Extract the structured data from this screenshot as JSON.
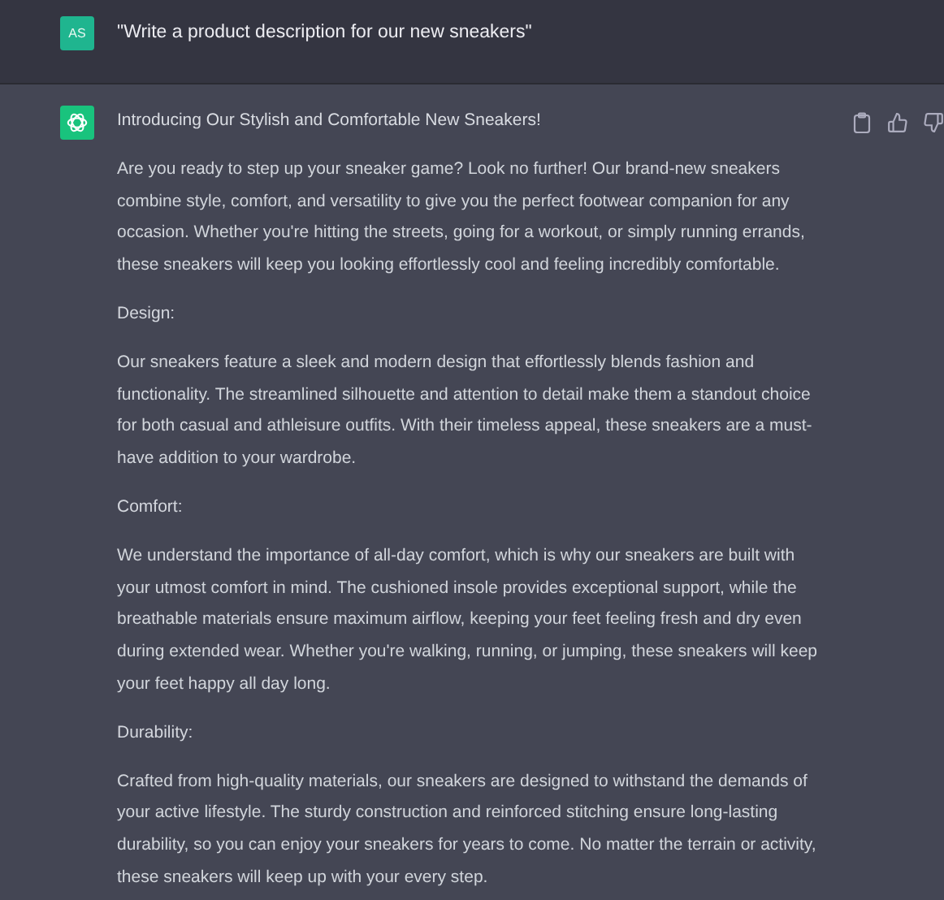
{
  "user_message": {
    "avatar": "AS",
    "text": "\"Write a product description for our new sneakers\""
  },
  "assistant_message": {
    "paragraphs": [
      {
        "kind": "title",
        "text": "Introducing Our Stylish and Comfortable New Sneakers!"
      },
      {
        "kind": "body",
        "text": "Are you ready to step up your sneaker game? Look no further! Our brand-new sneakers combine style, comfort, and versatility to give you the perfect footwear companion for any occasion. Whether you're hitting the streets, going for a workout, or simply running errands, these sneakers will keep you looking effortlessly cool and feeling incredibly comfortable."
      },
      {
        "kind": "heading",
        "text": "Design:"
      },
      {
        "kind": "body",
        "text": "Our sneakers feature a sleek and modern design that effortlessly blends fashion and functionality. The streamlined silhouette and attention to detail make them a standout choice for both casual and athleisure outfits. With their timeless appeal, these sneakers are a must-have addition to your wardrobe."
      },
      {
        "kind": "heading",
        "text": "Comfort:"
      },
      {
        "kind": "body",
        "text": "We understand the importance of all-day comfort, which is why our sneakers are built with your utmost comfort in mind. The cushioned insole provides exceptional support, while the breathable materials ensure maximum airflow, keeping your feet feeling fresh and dry even during extended wear. Whether you're walking, running, or jumping, these sneakers will keep your feet happy all day long."
      },
      {
        "kind": "heading",
        "text": "Durability:"
      },
      {
        "kind": "body",
        "text": "Crafted from high-quality materials, our sneakers are designed to withstand the demands of your active lifestyle. The sturdy construction and reinforced stitching ensure long-lasting durability, so you can enjoy your sneakers for years to come. No matter the terrain or activity, these sneakers will keep up with your every step."
      }
    ]
  }
}
